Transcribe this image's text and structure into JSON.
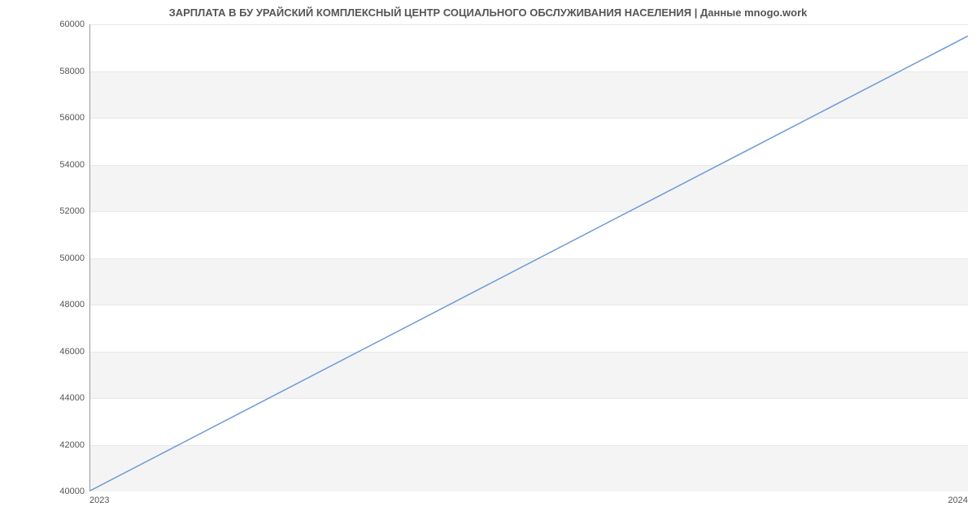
{
  "chart_data": {
    "type": "line",
    "title": "ЗАРПЛАТА В БУ УРАЙСКИЙ КОМПЛЕКСНЫЙ ЦЕНТР СОЦИАЛЬНОГО ОБСЛУЖИВАНИЯ НАСЕЛЕНИЯ | Данные mnogo.work",
    "xlabel": "",
    "ylabel": "",
    "x_categories": [
      "2023",
      "2024"
    ],
    "series": [
      {
        "name": "salary",
        "color": "#6a98d8",
        "values": [
          40000,
          59500
        ]
      }
    ],
    "ylim": [
      40000,
      60000
    ],
    "yticks": [
      40000,
      42000,
      44000,
      46000,
      48000,
      50000,
      52000,
      54000,
      56000,
      58000,
      60000
    ],
    "grid": true
  }
}
